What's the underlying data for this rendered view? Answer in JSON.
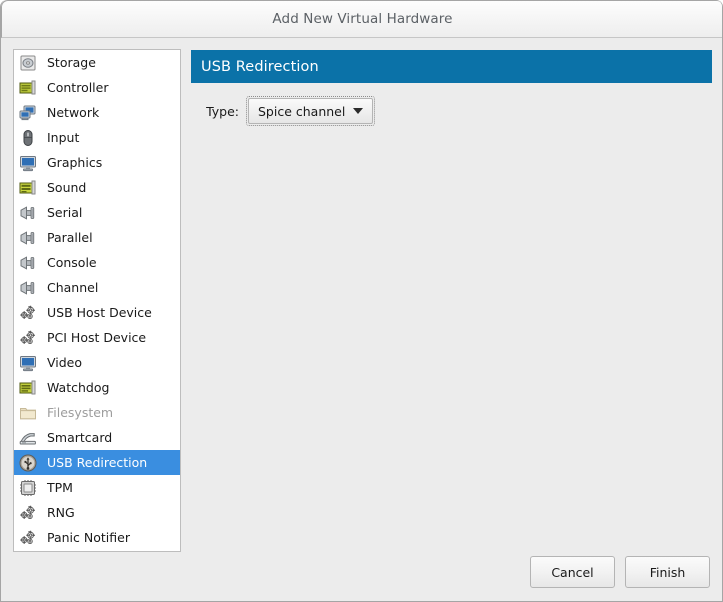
{
  "window": {
    "title": "Add New Virtual Hardware"
  },
  "colors": {
    "header_blue": "#0b72a8",
    "selection_blue": "#3a8ee0",
    "window_background": "#ececec",
    "list_background": "#ffffff",
    "disabled_text": "#9d9d9d"
  },
  "sidebar": {
    "items": [
      {
        "label": "Storage",
        "icon": "storage-disk-icon",
        "selected": false,
        "disabled": false
      },
      {
        "label": "Controller",
        "icon": "controller-card-icon",
        "selected": false,
        "disabled": false
      },
      {
        "label": "Network",
        "icon": "network-icon",
        "selected": false,
        "disabled": false
      },
      {
        "label": "Input",
        "icon": "mouse-icon",
        "selected": false,
        "disabled": false
      },
      {
        "label": "Graphics",
        "icon": "monitor-icon",
        "selected": false,
        "disabled": false
      },
      {
        "label": "Sound",
        "icon": "sound-card-icon",
        "selected": false,
        "disabled": false
      },
      {
        "label": "Serial",
        "icon": "plug-icon",
        "selected": false,
        "disabled": false
      },
      {
        "label": "Parallel",
        "icon": "plug-icon",
        "selected": false,
        "disabled": false
      },
      {
        "label": "Console",
        "icon": "plug-icon",
        "selected": false,
        "disabled": false
      },
      {
        "label": "Channel",
        "icon": "plug-icon",
        "selected": false,
        "disabled": false
      },
      {
        "label": "USB Host Device",
        "icon": "gears-icon",
        "selected": false,
        "disabled": false
      },
      {
        "label": "PCI Host Device",
        "icon": "gears-icon",
        "selected": false,
        "disabled": false
      },
      {
        "label": "Video",
        "icon": "monitor-icon",
        "selected": false,
        "disabled": false
      },
      {
        "label": "Watchdog",
        "icon": "watchdog-card-icon",
        "selected": false,
        "disabled": false
      },
      {
        "label": "Filesystem",
        "icon": "folder-icon",
        "selected": false,
        "disabled": true
      },
      {
        "label": "Smartcard",
        "icon": "smartcard-reader-icon",
        "selected": false,
        "disabled": false
      },
      {
        "label": "USB Redirection",
        "icon": "usb-icon",
        "selected": true,
        "disabled": false
      },
      {
        "label": "TPM",
        "icon": "chip-icon",
        "selected": false,
        "disabled": false
      },
      {
        "label": "RNG",
        "icon": "gears-icon",
        "selected": false,
        "disabled": false
      },
      {
        "label": "Panic Notifier",
        "icon": "gears-icon",
        "selected": false,
        "disabled": false
      }
    ]
  },
  "main": {
    "header_title": "USB Redirection",
    "type_field": {
      "label": "Type:",
      "value": "Spice channel"
    }
  },
  "footer": {
    "cancel_label": "Cancel",
    "finish_label": "Finish"
  }
}
